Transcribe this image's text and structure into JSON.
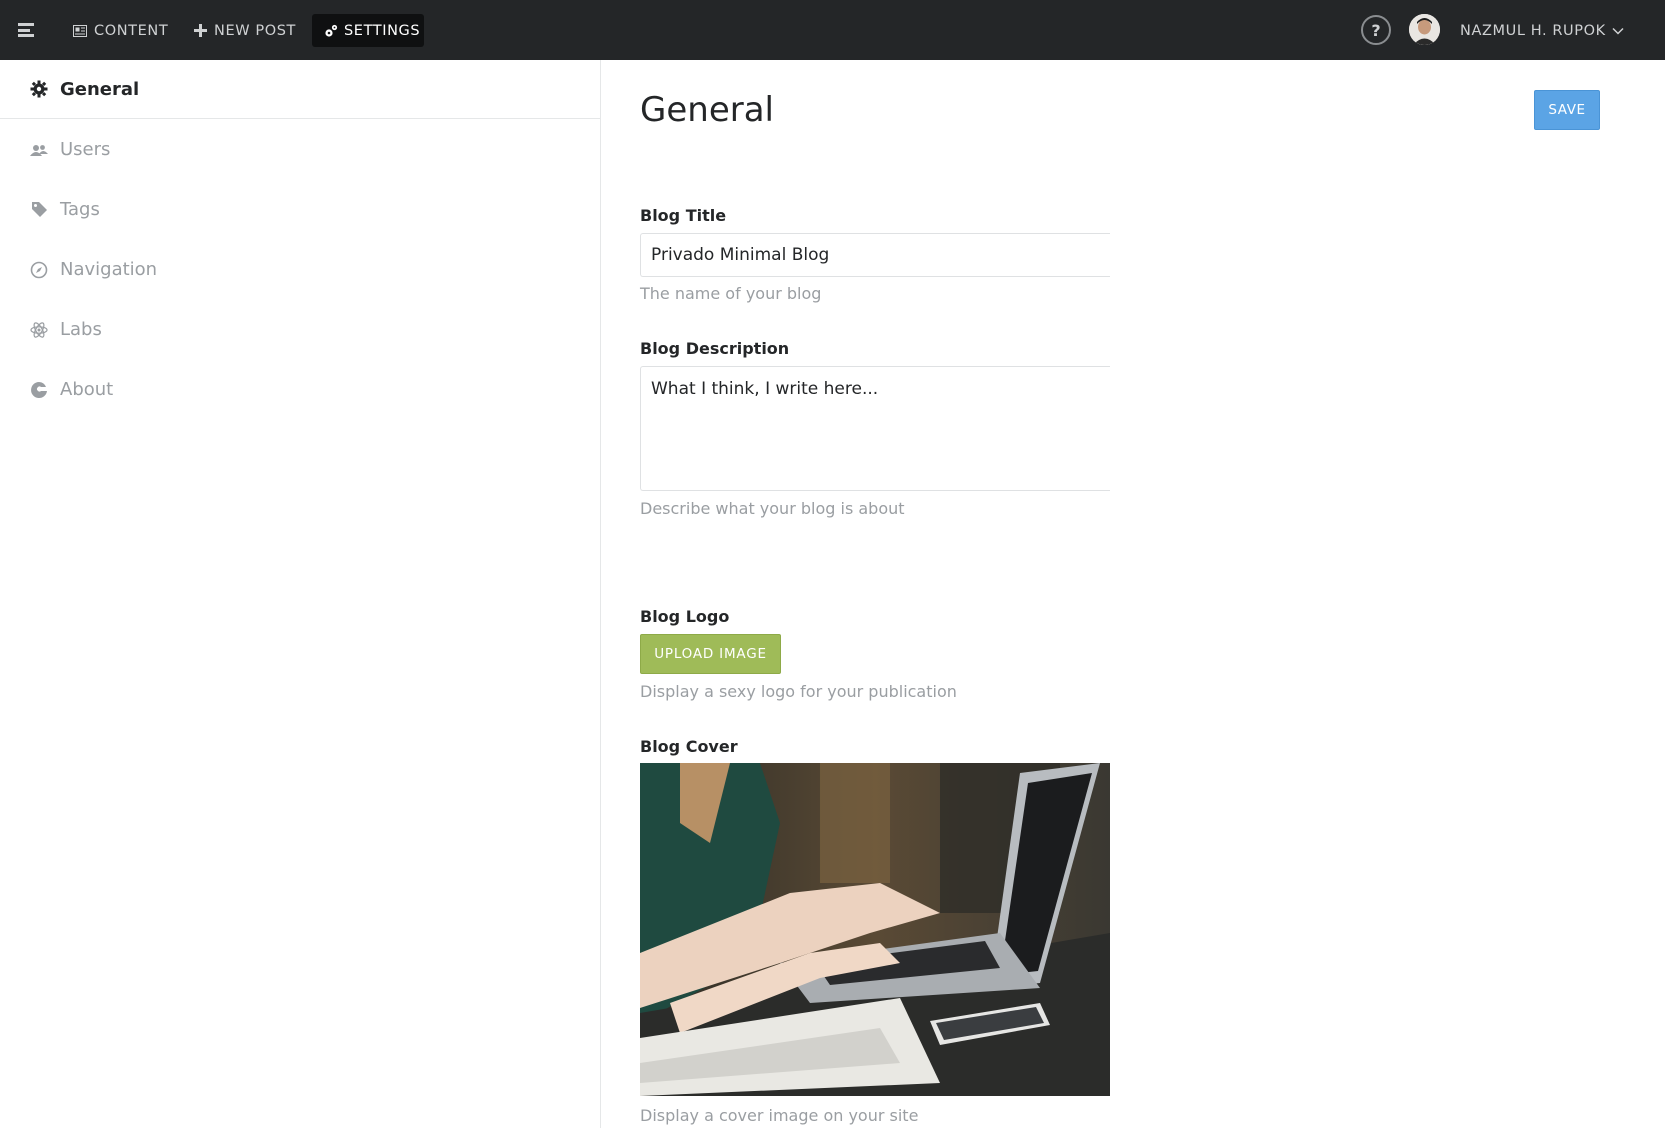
{
  "topbar": {
    "menu_icon": "menu-toggle-icon",
    "nav": [
      {
        "label": "CONTENT",
        "icon": "content-icon"
      },
      {
        "label": "NEW POST",
        "icon": "plus-icon"
      },
      {
        "label": "SETTINGS",
        "icon": "gears-icon",
        "active": true
      }
    ],
    "help_label": "?",
    "user_name": "NAZMUL H. RUPOK"
  },
  "sidebar": {
    "items": [
      {
        "label": "General",
        "icon": "gear-icon",
        "active": true
      },
      {
        "label": "Users",
        "icon": "users-icon"
      },
      {
        "label": "Tags",
        "icon": "tag-icon"
      },
      {
        "label": "Navigation",
        "icon": "compass-icon"
      },
      {
        "label": "Labs",
        "icon": "atom-icon"
      },
      {
        "label": "About",
        "icon": "ghost-icon"
      }
    ]
  },
  "main": {
    "title": "General",
    "save_label": "SAVE",
    "blog_title": {
      "label": "Blog Title",
      "value": "Privado Minimal Blog",
      "help": "The name of your blog"
    },
    "blog_description": {
      "label": "Blog Description",
      "value": "What I think, I write here...",
      "help": "Describe what your blog is about"
    },
    "blog_logo": {
      "label": "Blog Logo",
      "button": "UPLOAD IMAGE",
      "help": "Display a sexy logo for your publication"
    },
    "blog_cover": {
      "label": "Blog Cover",
      "help": "Display a cover image on your site"
    }
  },
  "colors": {
    "topbar_bg": "#242628",
    "active_nav_bg": "#0f1011",
    "save_blue": "#5ba4e5",
    "upload_green": "#9fbb58",
    "muted_text": "#9a9ea2"
  }
}
